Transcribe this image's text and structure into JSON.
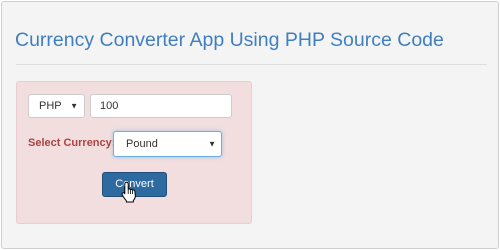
{
  "page": {
    "title": "Currency Converter App Using PHP Source Code"
  },
  "form": {
    "from_currency": "PHP",
    "amount": "100",
    "select_label": "Select Currency:",
    "to_currency": "Pound",
    "convert_label": "Convert"
  },
  "colors": {
    "title": "#3f7fbf",
    "panel_background": "#f2dede",
    "label": "#a94442",
    "button": "#2c6aa0"
  },
  "icons": {
    "dropdown": "chevron-down-icon",
    "cursor": "hand-pointer-cursor-icon"
  }
}
